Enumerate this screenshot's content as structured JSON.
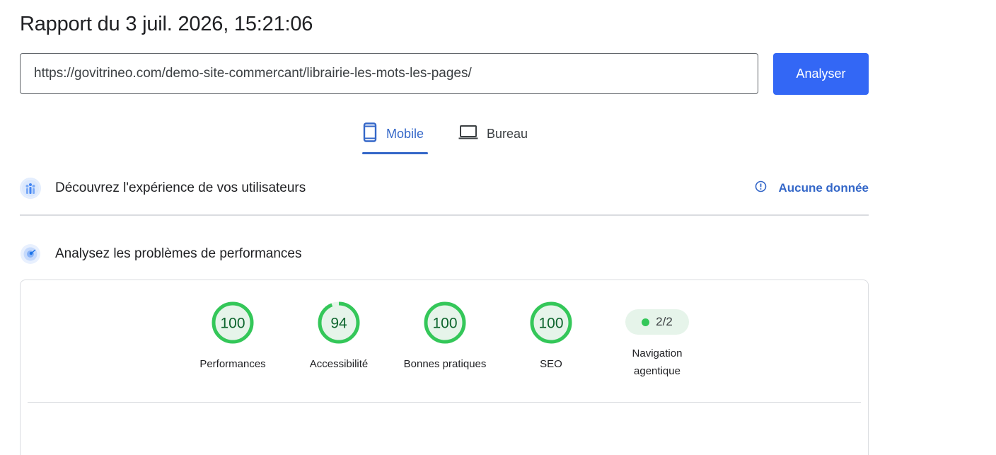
{
  "report": {
    "title": "Rapport du 3 juil. 2026, 15:21:06"
  },
  "search": {
    "url_value": "https://govitrineo.com/demo-site-commercant/librairie-les-mots-les-pages/",
    "analyze_label": "Analyser"
  },
  "tabs": {
    "mobile_label": "Mobile",
    "desktop_label": "Bureau",
    "active": "Mobile"
  },
  "ux_section": {
    "title": "Découvrez l'expérience de vos utilisateurs",
    "status_label": "Aucune donnée",
    "icon": "users-chart-icon",
    "status_icon": "info-icon"
  },
  "perf_section": {
    "title": "Analysez les problèmes de performances",
    "icon": "radar-icon"
  },
  "scores": [
    {
      "label": "Performances",
      "value": 100,
      "display": "100"
    },
    {
      "label": "Accessibilité",
      "value": 94,
      "display": "94"
    },
    {
      "label": "Bonnes pratiques",
      "value": 100,
      "display": "100"
    },
    {
      "label": "SEO",
      "value": 100,
      "display": "100"
    }
  ],
  "agentic": {
    "value": "2/2",
    "label_line1": "Navigation",
    "label_line2": "agentique"
  },
  "colors": {
    "accent": "#3367f5",
    "link": "#3467c8",
    "score_good": "#34c759",
    "score_bg": "#e6f4ea"
  }
}
